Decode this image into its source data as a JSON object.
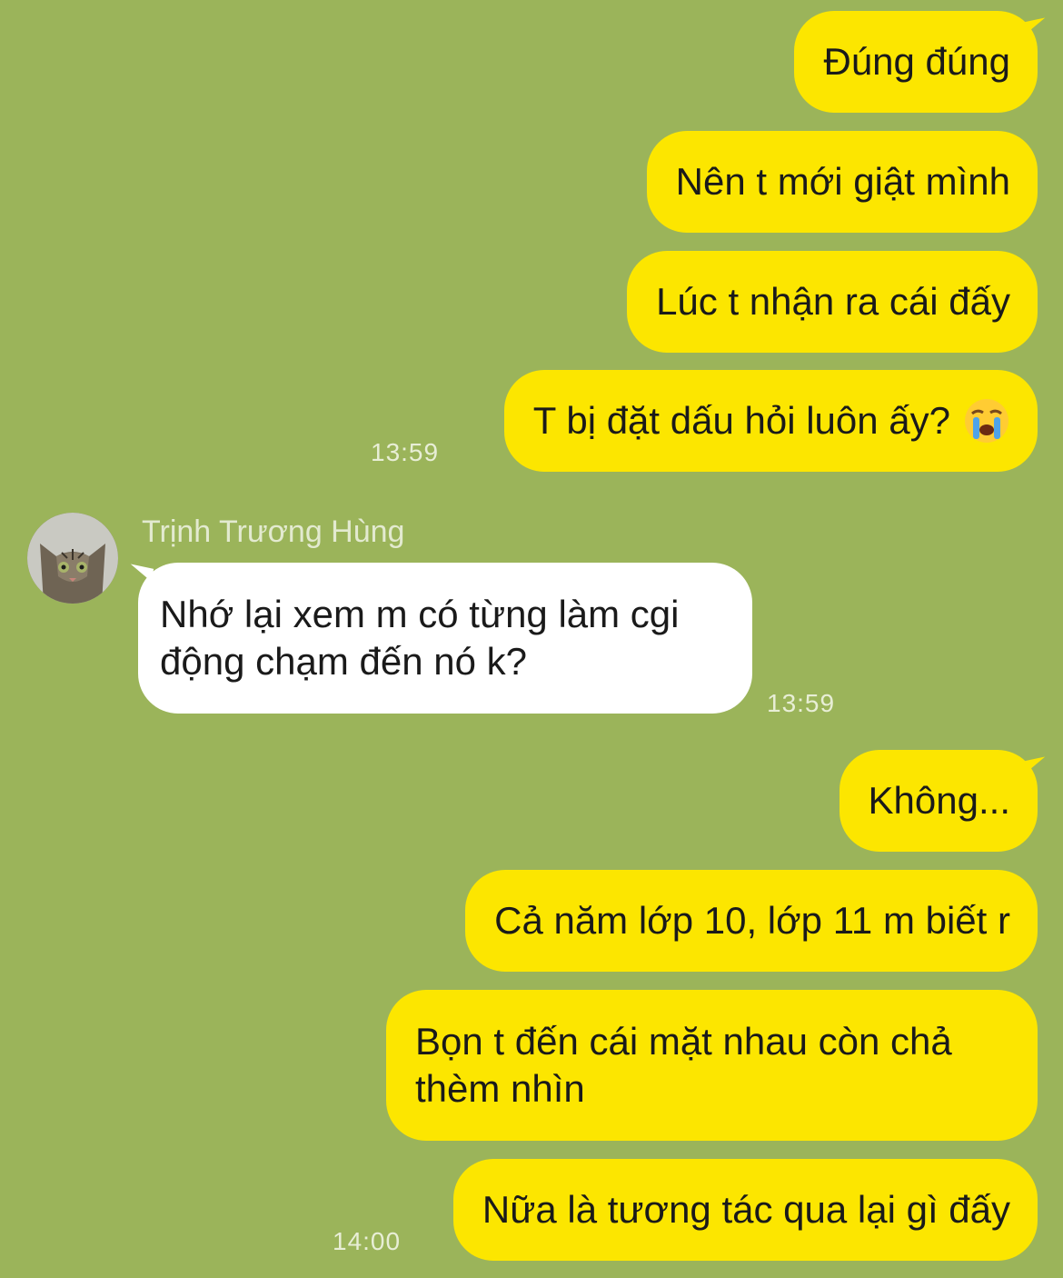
{
  "messages_top": {
    "m1": "Đúng đúng",
    "m2": "Nên t mới giật mình",
    "m3": "Lúc t nhận ra cái đấy",
    "m4": "T bị đặt dấu hỏi luôn ấy?",
    "m4_emoji": "crying-face-icon",
    "time1": "13:59"
  },
  "incoming": {
    "sender": "Trịnh Trương Hùng",
    "line1": "Nhớ lại xem m có từng làm cgi",
    "line2": "động chạm đến nó k?",
    "time": "13:59"
  },
  "messages_bottom": {
    "m5": "Không...",
    "m6": "Cả năm lớp 10, lớp 11 m biết r",
    "m7_line1": "Bọn t đến cái mặt nhau còn chả",
    "m7_line2": "thèm nhìn",
    "m8": "Nữa là tương tác qua lại gì đấy",
    "time2": "14:00"
  },
  "colors": {
    "background": "#9bb45a",
    "outgoing_bubble": "#fce600",
    "incoming_bubble": "#ffffff"
  }
}
